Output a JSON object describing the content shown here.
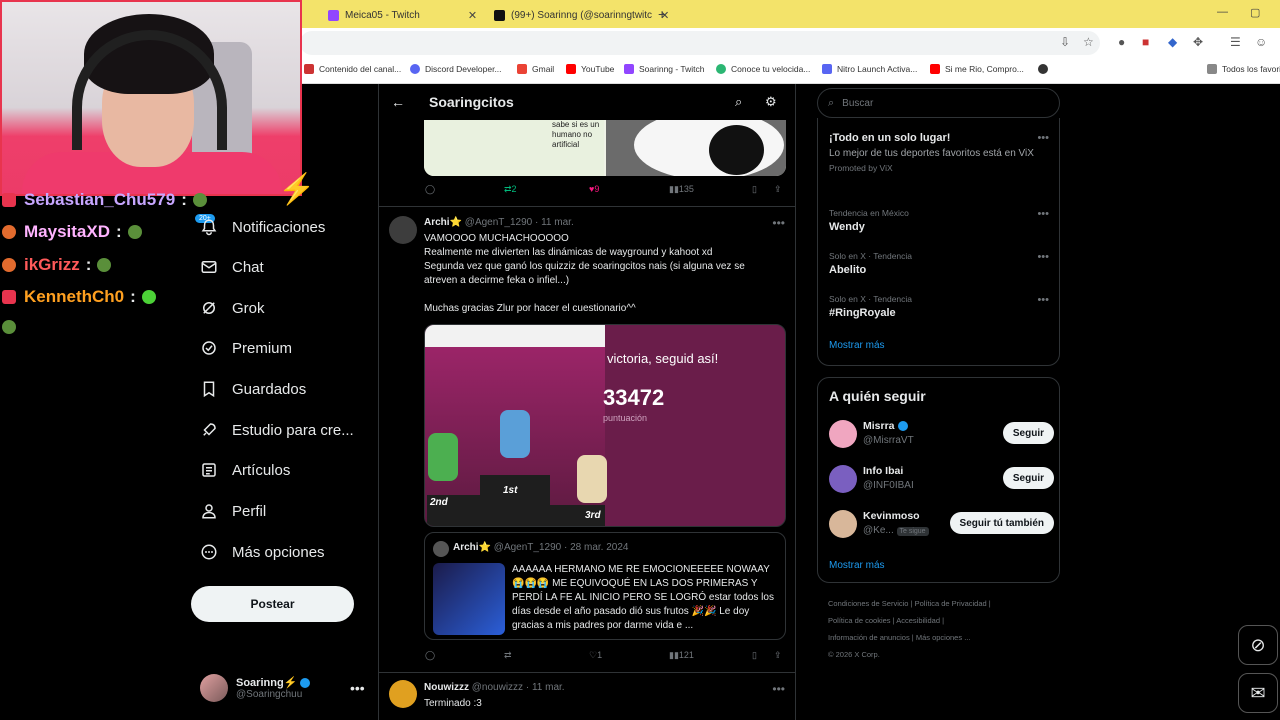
{
  "browser": {
    "tabs": [
      {
        "title": "Meica05 - Twitch"
      },
      {
        "title": "(99+) Soarinng (@soarinngtwitc"
      }
    ],
    "new_tab": "+",
    "bookmarks": [
      {
        "label": "Contenido del canal..."
      },
      {
        "label": "Discord Developer..."
      },
      {
        "label": "Gmail"
      },
      {
        "label": "YouTube"
      },
      {
        "label": "Soarinng - Twitch"
      },
      {
        "label": "Conoce tu velocida..."
      },
      {
        "label": "Nitro Launch Activa..."
      },
      {
        "label": "Si me Rio, Compro..."
      },
      {
        "label": "Todos los favoritos"
      }
    ]
  },
  "chat": [
    {
      "user": "Sebastian_Chu579",
      "sep": ":",
      "color": "#c7a6ff"
    },
    {
      "user": "MaysitaXD",
      "sep": ":",
      "color": "#ffb3ff"
    },
    {
      "user": "ikGrizz",
      "sep": ":",
      "color": "#ff5a5a"
    },
    {
      "user": "KennethCh0",
      "sep": ":",
      "color": "#ffa020"
    }
  ],
  "nav": {
    "badge": "20+",
    "items": [
      {
        "label": "Notificaciones"
      },
      {
        "label": "Chat"
      },
      {
        "label": "Grok"
      },
      {
        "label": "Premium"
      },
      {
        "label": "Guardados"
      },
      {
        "label": "Estudio para cre..."
      },
      {
        "label": "Artículos"
      },
      {
        "label": "Perfil"
      },
      {
        "label": "Más opciones"
      }
    ],
    "post_button": "Postear",
    "account": {
      "name": "Soarinng⚡",
      "handle": "@Soaringchuu"
    }
  },
  "main": {
    "title": "Soaringcitos",
    "top_image_text": "sabe si es un humano no artificial",
    "top_actions": {
      "retweets": "2",
      "likes": "9",
      "views": "135"
    },
    "tweet": {
      "name": "Archi⭐",
      "handle": "@AgenT_1290",
      "date": "· 11 mar.",
      "lines": [
        "VAMOOOO MUCHACHOOOOO",
        "Realmente me divierten las dinámicas de wayground y kahoot xd",
        "Segunda vez que ganó los quizziz de soaringcitos nais (si alguna vez se atreven a decirme feka o infiel...)",
        "",
        "Muchas gracias Zlur por hacer el cuestionario^^"
      ],
      "media": {
        "victory": "victoria, seguid así!",
        "score": "33472",
        "score_label": "puntuación",
        "first": "1st",
        "second": "2nd",
        "third": "3rd"
      },
      "quote": {
        "name": "Archi⭐",
        "handle": "@AgenT_1290",
        "date": "· 28 mar. 2024",
        "text": "AAAAAA HERMANO ME RE EMOCIONEEEEE NOWAAY 😭😭😭 ME EQUIVOQUÉ EN LAS DOS PRIMERAS Y PERDÍ LA FE AL INICIO PERO SE LOGRÓ estar todos los días desde el año pasado dió sus frutos 🎉🎉 Le doy gracias a mis padres por darme vida e ..."
      },
      "actions": {
        "likes": "1",
        "views": "121"
      }
    },
    "next_tweet": {
      "name": "Nouwizzz",
      "handle": "@nouwizzz",
      "date": "· 11 mar.",
      "text": "Terminado :3"
    }
  },
  "right": {
    "search_placeholder": "Buscar",
    "ad": {
      "title": "¡Todo en un solo lugar!",
      "text": "Lo mejor de tus deportes favoritos está en ViX",
      "promo": "Promoted by ViX"
    },
    "trends": [
      {
        "context": "Tendencia en México",
        "name": "Wendy"
      },
      {
        "context": "Solo en X · Tendencia",
        "name": "Abelito"
      },
      {
        "context": "Solo en X · Tendencia",
        "name": "#RingRoyale"
      }
    ],
    "show_more": "Mostrar más",
    "who_to_follow": {
      "title": "A quién seguir",
      "accounts": [
        {
          "name": "Misrra",
          "handle": "@MisrraVT",
          "button": "Seguir"
        },
        {
          "name": "Info Ibai",
          "handle": "@INF0IBAI",
          "button": "Seguir"
        },
        {
          "name": "Kevinmoso",
          "handle": "@Ke...",
          "follows_you": "Te sigue",
          "button": "Seguir tú también"
        }
      ],
      "show_more": "Mostrar más"
    },
    "footer": [
      "Condiciones de Servicio | Política de Privacidad |",
      "Política de cookies | Accesibilidad |",
      "Información de anuncios | Más opciones ...",
      "© 2026 X Corp."
    ]
  }
}
